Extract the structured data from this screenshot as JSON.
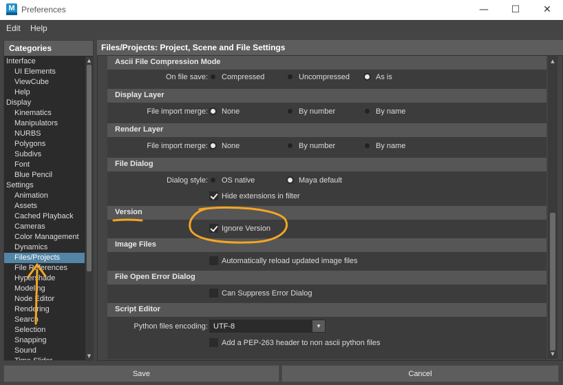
{
  "window": {
    "title": "Preferences",
    "app_icon_letter": "M",
    "min_glyph": "—",
    "max_glyph": "☐",
    "close_glyph": "✕"
  },
  "menu": {
    "items": [
      "Edit",
      "Help"
    ]
  },
  "categories": {
    "header": "Categories",
    "items": [
      {
        "label": "Interface",
        "level": 0
      },
      {
        "label": "UI Elements",
        "level": 1
      },
      {
        "label": "ViewCube",
        "level": 1
      },
      {
        "label": "Help",
        "level": 1
      },
      {
        "label": "Display",
        "level": 0
      },
      {
        "label": "Kinematics",
        "level": 1
      },
      {
        "label": "Manipulators",
        "level": 1
      },
      {
        "label": "NURBS",
        "level": 1
      },
      {
        "label": "Polygons",
        "level": 1
      },
      {
        "label": "Subdivs",
        "level": 1
      },
      {
        "label": "Font",
        "level": 1
      },
      {
        "label": "Blue Pencil",
        "level": 1
      },
      {
        "label": "Settings",
        "level": 0
      },
      {
        "label": "Animation",
        "level": 1
      },
      {
        "label": "Assets",
        "level": 1
      },
      {
        "label": "Cached Playback",
        "level": 1
      },
      {
        "label": "Cameras",
        "level": 1
      },
      {
        "label": "Color Management",
        "level": 1
      },
      {
        "label": "Dynamics",
        "level": 1
      },
      {
        "label": "Files/Projects",
        "level": 1,
        "selected": true
      },
      {
        "label": "File References",
        "level": 1
      },
      {
        "label": "Hypershade",
        "level": 1
      },
      {
        "label": "Modeling",
        "level": 1
      },
      {
        "label": "Node Editor",
        "level": 1
      },
      {
        "label": "Rendering",
        "level": 1
      },
      {
        "label": "Search",
        "level": 1
      },
      {
        "label": "Selection",
        "level": 1
      },
      {
        "label": "Snapping",
        "level": 1
      },
      {
        "label": "Sound",
        "level": 1
      },
      {
        "label": "Time Slider",
        "level": 1
      }
    ],
    "scroll_up": "▲",
    "scroll_down": "▼"
  },
  "main": {
    "header": "Files/Projects: Project, Scene and File Settings",
    "scroll_up": "▲",
    "scroll_down": "▼",
    "ascii": {
      "title": "Ascii File Compression Mode",
      "label": "On file save:",
      "options": [
        "Compressed",
        "Uncompressed",
        "As is"
      ],
      "selected": 2
    },
    "display_layer": {
      "title": "Display Layer",
      "label": "File import merge:",
      "options": [
        "None",
        "By number",
        "By name"
      ],
      "selected": 0
    },
    "render_layer": {
      "title": "Render Layer",
      "label": "File import merge:",
      "options": [
        "None",
        "By number",
        "By name"
      ],
      "selected": 0
    },
    "file_dialog": {
      "title": "File Dialog",
      "label": "Dialog style:",
      "options": [
        "OS native",
        "Maya default"
      ],
      "selected": 1,
      "hide_ext_label": "Hide extensions in filter",
      "hide_ext_checked": true
    },
    "version": {
      "title": "Version",
      "ignore_label": "Ignore Version",
      "ignore_checked": true
    },
    "image_files": {
      "title": "Image Files",
      "reload_label": "Automatically reload updated image files",
      "reload_checked": false
    },
    "file_open_error": {
      "title": "File Open Error Dialog",
      "suppress_label": "Can Suppress Error Dialog",
      "suppress_checked": false
    },
    "script_editor": {
      "title": "Script Editor",
      "encoding_label": "Python files encoding:",
      "encoding_value": "UTF-8",
      "pep_label": "Add a PEP-263 header to non ascii python files",
      "pep_checked": false
    }
  },
  "buttons": {
    "save": "Save",
    "cancel": "Cancel"
  },
  "colors": {
    "annotation": "#f5a623",
    "selection": "#5285a6",
    "app_icon": "#1f8fc9"
  }
}
